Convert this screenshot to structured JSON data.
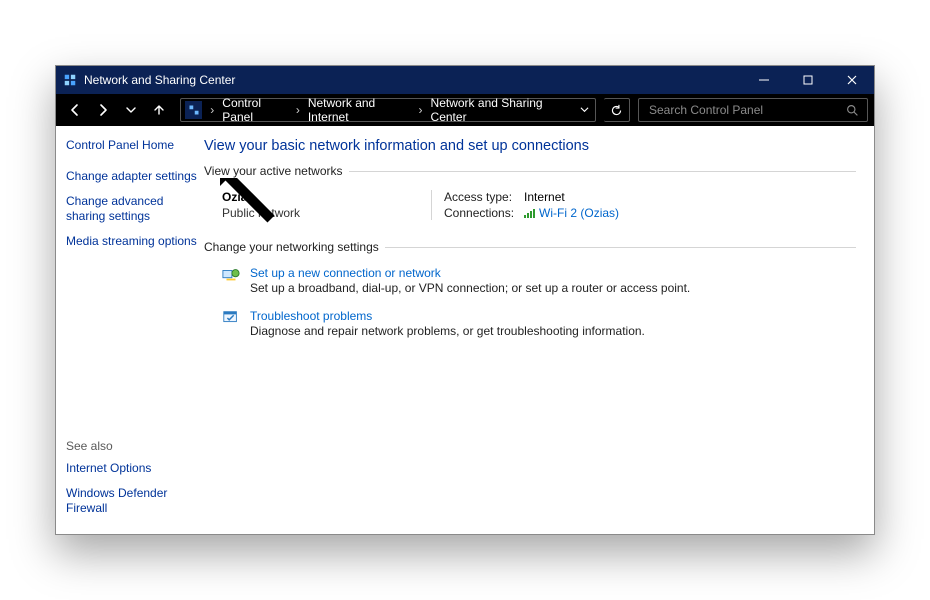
{
  "title": "Network and Sharing Center",
  "breadcrumb": [
    "Control Panel",
    "Network and Internet",
    "Network and Sharing Center"
  ],
  "search_placeholder": "Search Control Panel",
  "sidebar": {
    "home": "Control Panel Home",
    "items": [
      "Change adapter settings",
      "Change advanced sharing settings",
      "Media streaming options"
    ],
    "see_also_heading": "See also",
    "see_also": [
      "Internet Options",
      "Windows Defender Firewall"
    ]
  },
  "main": {
    "heading": "View your basic network information and set up connections",
    "section_active": "View your active networks",
    "network": {
      "name": "Ozias",
      "type": "Public network",
      "access_label": "Access type:",
      "access_value": "Internet",
      "conn_label": "Connections:",
      "conn_value": "Wi-Fi 2 (Ozias)"
    },
    "section_change": "Change your networking settings",
    "tasks": [
      {
        "link": "Set up a new connection or network",
        "desc": "Set up a broadband, dial-up, or VPN connection; or set up a router or access point."
      },
      {
        "link": "Troubleshoot problems",
        "desc": "Diagnose and repair network problems, or get troubleshooting information."
      }
    ]
  }
}
